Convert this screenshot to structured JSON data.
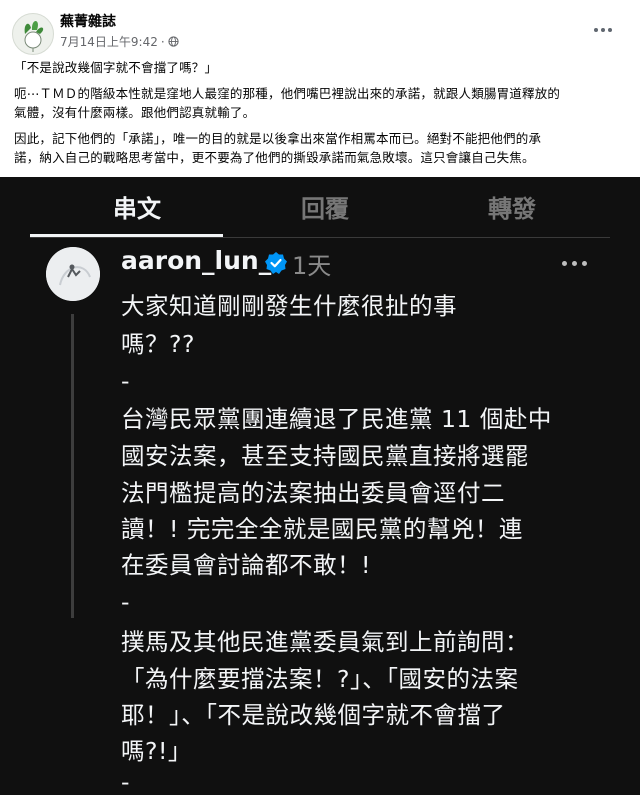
{
  "post": {
    "page_name": "蕪菁雜誌",
    "timestamp": "7月14日上午9:42",
    "privacy_icon": "globe-icon",
    "quote": "「不是說改幾個字就不會擋了嗎？」",
    "paragraph1": [
      "呃⋯ＴＭＤ的階級本性就是窪地人最窪的那種，他們嘴巴裡說出來的承諾，就跟人類腸胃道釋放的",
      "氣體，沒有什麼兩樣。跟他們認真就輸了。"
    ],
    "paragraph2": [
      "因此，記下他們的「承諾」，唯一的目的就是以後拿出來當作相罵本而已。絕對不能把他們的承",
      "諾，納入自己的戰略思考當中，更不要為了他們的撕毀承諾而氣急敗壞。這只會讓自己失焦。"
    ]
  },
  "threads": {
    "tabs": [
      "串文",
      "回覆",
      "轉發"
    ],
    "active_tab": "串文",
    "username": "aaron_lun_",
    "verified_icon": "verified-badge-icon",
    "time": "1天",
    "body_lines": [
      "大家知道剛剛發生什麼很扯的事",
      "嗎？??",
      "-",
      "台灣民眾黨團連續退了民進黨 11 個赴中",
      "國安法案，甚至支持國民黨直接將選罷",
      "法門檻提高的法案抽出委員會逕付二",
      "讀！!  完完全全就是國民黨的幫兇！連",
      "在委員會討論都不敢！!",
      "-",
      "撲馬及其他民進黨委員氣到上前詢問：",
      "「為什麼要擋法案！?」、「國安的法案",
      "耶！」、「不是說改幾個字就不會擋了",
      "嗎?!」",
      "-"
    ]
  },
  "colors": {
    "threads_bg": "#101010",
    "threads_text": "#f3f5f7",
    "muted": "#777777",
    "verified": "#0095f6",
    "fb_secondary": "#65676b"
  }
}
